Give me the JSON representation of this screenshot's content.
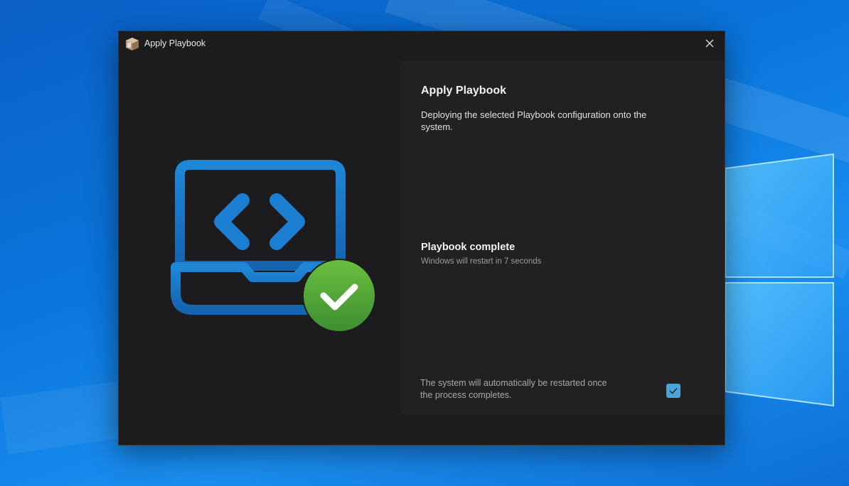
{
  "window": {
    "title": "Apply Playbook"
  },
  "panel": {
    "title": "Apply Playbook",
    "description": "Deploying the selected Playbook configuration onto the system."
  },
  "status": {
    "title": "Playbook complete",
    "subtitle": "Windows will restart in 7 seconds"
  },
  "footer": {
    "restart_note": "The system will automatically be restarted once the process completes.",
    "restart_checked": true
  },
  "icons": {
    "app": "package-box-icon",
    "close": "close-icon",
    "illustration": "laptop-code-icon",
    "success": "checkmark-circle-icon",
    "checkbox": "checkmark-icon"
  },
  "colors": {
    "accent_blue": "#1a78c8",
    "success_green": "#4aa03c",
    "checkbox_blue": "#4ba3d6"
  }
}
